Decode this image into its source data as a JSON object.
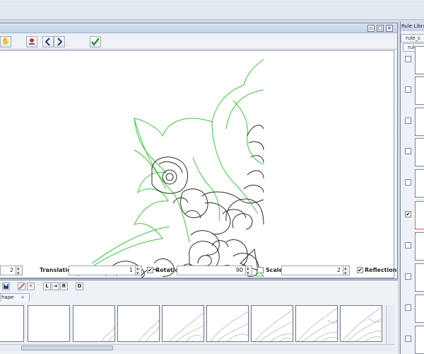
{
  "main": {
    "toolbar": {
      "icons": [
        "pan-hand-icon",
        "stamp-icon",
        "prev-arrow-icon",
        "next-arrow-icon",
        "apply-check-icon"
      ]
    },
    "params": {
      "first_value": "2",
      "translation_label": "Translation",
      "translation_value": "1",
      "rotation_label": "Rotation",
      "rotation_value": "90",
      "rotation_checked": "✔",
      "scale_label": "Scale",
      "scale_value": "2",
      "reflection_label": "Reflection",
      "reflection_checked": "✔"
    }
  },
  "shape_panel": {
    "tab_label": "hape",
    "tab_close": "×",
    "buttons": [
      "save",
      "edit",
      "delete",
      "L",
      "R",
      "D"
    ]
  },
  "rules_panel": {
    "title": "Rule Libra",
    "tab1": "rule_c",
    "tab2": "rule_a",
    "checked_rule": "✔"
  },
  "colors": {
    "shape_stroke": "#2b2b2b",
    "rule_stroke": "#3fc43f",
    "selected_rule_border": "#e0646b"
  }
}
